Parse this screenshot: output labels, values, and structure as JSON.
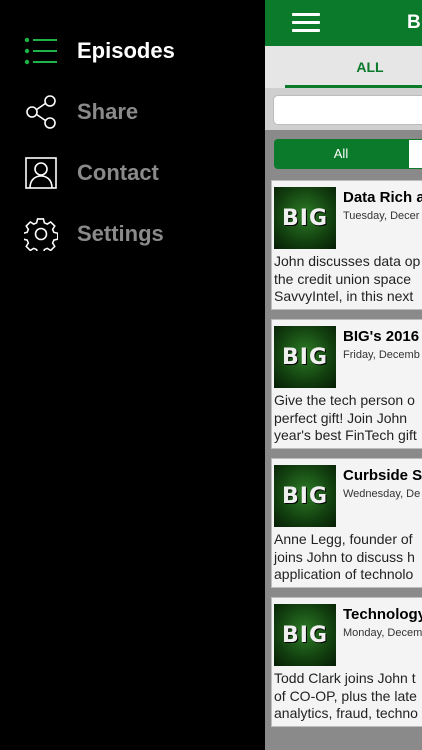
{
  "menu": {
    "items": [
      {
        "label": "Episodes",
        "icon": "list-icon",
        "active": true
      },
      {
        "label": "Share",
        "icon": "share-icon",
        "active": false
      },
      {
        "label": "Contact",
        "icon": "contact-icon",
        "active": false
      },
      {
        "label": "Settings",
        "icon": "gear-icon",
        "active": false
      }
    ]
  },
  "header": {
    "title": "Bi"
  },
  "tabs": {
    "all": "ALL"
  },
  "search": {
    "value": "",
    "placeholder": ""
  },
  "filter": {
    "all": "All"
  },
  "episodes": [
    {
      "thumb": "BIG",
      "title": "Data Rich a",
      "date": "Tuesday, Decer",
      "lines": [
        "John discusses data op",
        "the credit union space",
        "SavvyIntel, in this next"
      ]
    },
    {
      "thumb": "BIG",
      "title": "BIG's 2016",
      "date": "Friday, Decemb",
      "lines": [
        "Give the tech person o",
        "perfect gift! Join John",
        "year's best FinTech gift"
      ]
    },
    {
      "thumb": "BIG",
      "title": "Curbside S",
      "date": "Wednesday, De",
      "lines": [
        "Anne Legg, founder of",
        "joins John to discuss h",
        "application of technolo"
      ]
    },
    {
      "thumb": "BIG",
      "title": "Technology",
      "date": "Monday, Decem",
      "lines": [
        "Todd Clark joins John t",
        "of CO-OP, plus the late",
        "analytics, fraud, techno"
      ]
    }
  ],
  "colors": {
    "accent": "#0b7a2b",
    "drawer_bg": "#000000",
    "inactive_text": "#8a8a8a"
  }
}
